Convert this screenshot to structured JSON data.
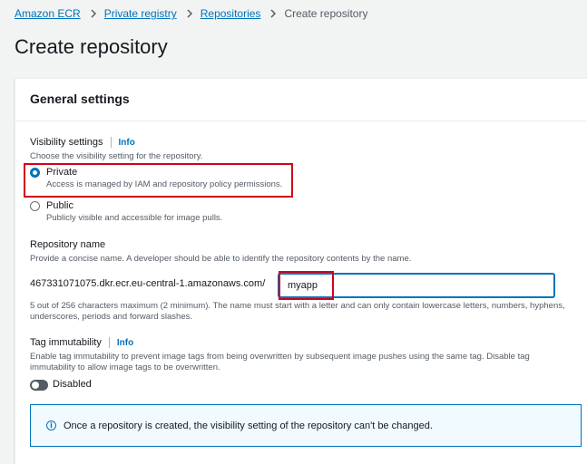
{
  "breadcrumb": {
    "items": [
      "Amazon ECR",
      "Private registry",
      "Repositories"
    ],
    "current": "Create repository"
  },
  "page_title": "Create repository",
  "general_settings": {
    "title": "General settings",
    "visibility": {
      "label": "Visibility settings",
      "info": "Info",
      "description": "Choose the visibility setting for the repository.",
      "selected": "Private",
      "options": [
        {
          "label": "Private",
          "description": "Access is managed by IAM and repository policy permissions."
        },
        {
          "label": "Public",
          "description": "Publicly visible and accessible for image pulls."
        }
      ]
    },
    "repository_name": {
      "label": "Repository name",
      "description": "Provide a concise name. A developer should be able to identify the repository contents by the name.",
      "prefix": "467331071075.dkr.ecr.eu-central-1.amazonaws.com/",
      "value": "myapp",
      "constraint": "5 out of 256 characters maximum (2 minimum). The name must start with a letter and can only contain lowercase letters, numbers, hyphens, underscores, periods and forward slashes."
    },
    "tag_immutability": {
      "label": "Tag immutability",
      "info": "Info",
      "description": "Enable tag immutability to prevent image tags from being overwritten by subsequent image pushes using the same tag. Disable tag immutability to allow image tags to be overwritten.",
      "state": "Disabled"
    },
    "alert": {
      "text": "Once a repository is created, the visibility setting of the repository can't be changed."
    }
  },
  "colors": {
    "link": "#0073bb",
    "highlight": "#d0021b",
    "alert_bg": "#f1faff"
  }
}
